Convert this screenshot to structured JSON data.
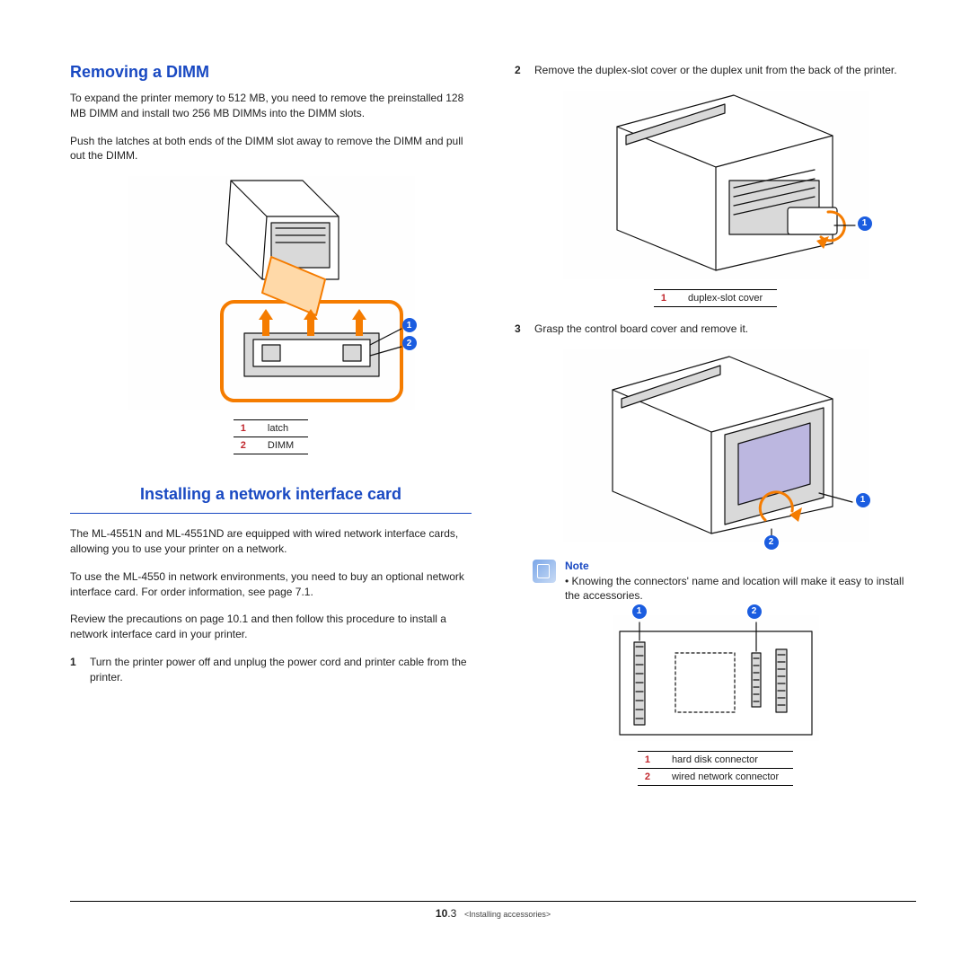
{
  "left": {
    "heading1": "Removing a DIMM",
    "para1": "To expand the printer memory to 512 MB, you need to remove the preinstalled 128 MB DIMM and install two 256 MB DIMMs into the DIMM slots.",
    "para2": "Push the latches at both ends of the DIMM slot away to remove the DIMM and pull out the DIMM.",
    "fig1_legend": [
      {
        "num": "1",
        "label": "latch"
      },
      {
        "num": "2",
        "label": "DIMM"
      }
    ],
    "heading2": "Installing a network interface card",
    "para3": "The ML-4551N and ML-4551ND are equipped with wired network interface cards, allowing you to use your printer on a network.",
    "para4": "To use the ML-4550 in network environments, you need to buy an optional network interface card. For order information, see page 7.1.",
    "para5": "Review the precautions on page 10.1 and then follow this procedure to install a network interface card in your printer.",
    "step1_num": "1",
    "step1": "Turn the printer power off and unplug the power cord and printer cable from the printer."
  },
  "right": {
    "step2_num": "2",
    "step2": "Remove the duplex-slot cover or the duplex unit from the back of the printer.",
    "fig2_legend": [
      {
        "num": "1",
        "label": "duplex-slot cover"
      }
    ],
    "step3_num": "3",
    "step3": "Grasp the control board cover and remove it.",
    "note_label": "Note",
    "note_text": "Knowing the connectors' name and location will make it easy to install the accessories.",
    "fig4_legend": [
      {
        "num": "1",
        "label": "hard disk connector"
      },
      {
        "num": "2",
        "label": "wired network connector"
      }
    ]
  },
  "footer": {
    "page_major": "10",
    "page_minor": ".3",
    "chapter": "<Installing accessories>"
  }
}
